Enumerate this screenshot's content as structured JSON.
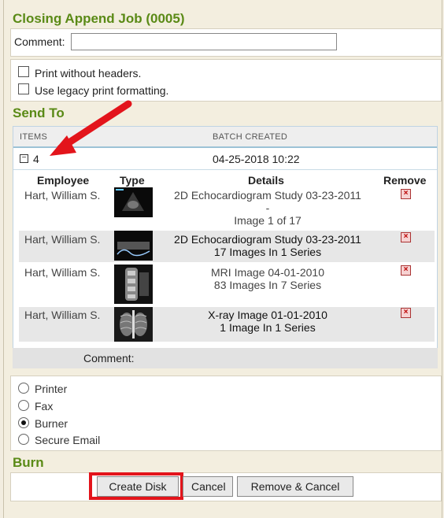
{
  "job": {
    "title": "Closing Append Job (0005)",
    "comment_label": "Comment:",
    "comment_value": ""
  },
  "options": {
    "print_without_headers": "Print without headers.",
    "legacy_print": "Use legacy print formatting."
  },
  "send_to": {
    "title": "Send To",
    "columns": {
      "items": "ITEMS",
      "batch_created": "BATCH CREATED"
    },
    "batch": {
      "count": "4",
      "created": "04-25-2018 10:22",
      "toggle_icon": "minus-square-icon"
    },
    "detail_headers": {
      "employee": "Employee",
      "type": "Type",
      "details": "Details",
      "remove": "Remove"
    },
    "rows": [
      {
        "employee": "Hart, William S.",
        "thumb": "echocardiogram",
        "details_line1": "2D Echocardiogram Study 03-23-2011",
        "details_line2": "-",
        "details_line3": "Image 1 of 17"
      },
      {
        "employee": "Hart, William S.",
        "thumb": "echocardiogram",
        "details_line1": "2D Echocardiogram Study 03-23-2011",
        "details_line2": "17 Images In 1 Series"
      },
      {
        "employee": "Hart, William S.",
        "thumb": "mri",
        "details_line1": "MRI Image 04-01-2010",
        "details_line2": "83 Images In 7 Series"
      },
      {
        "employee": "Hart, William S.",
        "thumb": "xray",
        "details_line1": "X-ray Image 01-01-2010",
        "details_line2": "1 Image In 1 Series"
      }
    ],
    "comment_label": "Comment:"
  },
  "delivery": {
    "options": [
      "Printer",
      "Fax",
      "Burner",
      "Secure Email"
    ],
    "selected": "Burner"
  },
  "burn": {
    "title": "Burn",
    "buttons": {
      "create": "Create Disk",
      "cancel": "Cancel",
      "remove_cancel": "Remove & Cancel"
    }
  },
  "colors": {
    "title_green": "#5a8a16",
    "highlight_red": "#e3141b",
    "arrow_red": "#e3141b"
  }
}
